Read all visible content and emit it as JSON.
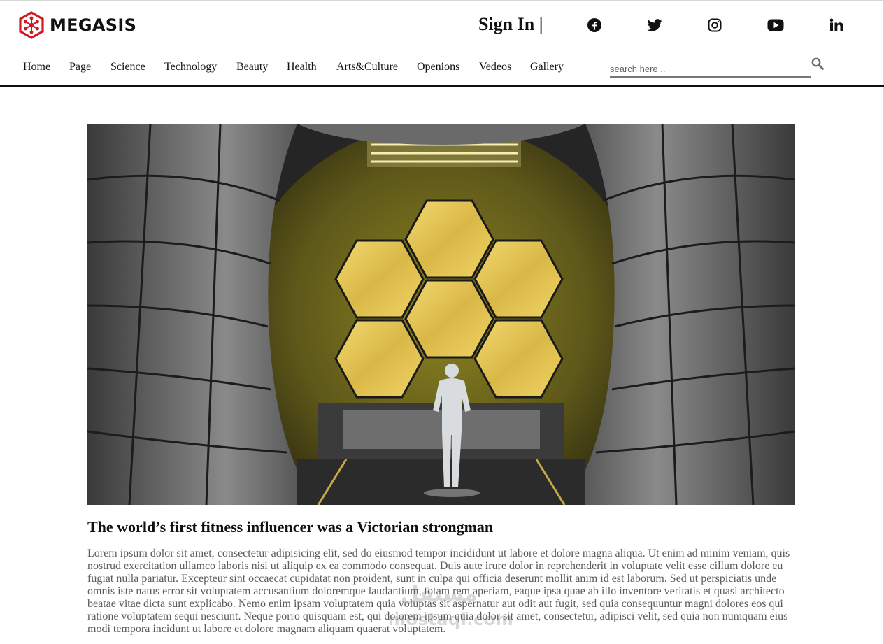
{
  "header": {
    "brand_name": "MEGASIS",
    "brand_color": "#d0181f",
    "sign_in_label": "Sign In |",
    "social_icons": [
      "facebook-icon",
      "twitter-icon",
      "instagram-icon",
      "youtube-icon",
      "linkedin-icon"
    ]
  },
  "nav": {
    "items": [
      {
        "label": "Home"
      },
      {
        "label": "Page"
      },
      {
        "label": "Science"
      },
      {
        "label": "Technology"
      },
      {
        "label": "Beauty"
      },
      {
        "label": "Health"
      },
      {
        "label": "Arts&Culture"
      },
      {
        "label": "Openions"
      },
      {
        "label": "Vedeos"
      },
      {
        "label": "Gallery"
      }
    ]
  },
  "search": {
    "placeholder": "search here ..",
    "value": "",
    "icon": "search-icon"
  },
  "article": {
    "image_icon": "telescope-mirror-photo",
    "title": "The world’s first fitness influencer was a Victorian strongman",
    "body": "Lorem ipsum dolor sit amet, consectetur adipisicing elit, sed do eiusmod tempor incididunt ut labore et dolore magna aliqua. Ut enim ad minim veniam, quis nostrud exercitation ullamco laboris nisi ut aliquip ex ea commodo consequat. Duis aute irure dolor in reprehenderit in voluptate velit esse cillum dolore eu fugiat nulla pariatur. Excepteur sint occaecat cupidatat non proident, sunt in culpa qui officia deserunt mollit anim id est laborum. Sed ut perspiciatis unde omnis iste natus error sit voluptatem accusantium doloremque laudantium, totam rem aperiam, eaque ipsa quae ab illo inventore veritatis et quasi architecto beatae vitae dicta sunt explicabo. Nemo enim ipsam voluptatem quia voluptas sit aspernatur aut odit aut fugit, sed quia consequuntur magni dolores eos qui ratione voluptatem sequi nesciunt. Neque porro quisquam est, qui dolorem ipsum quia dolor sit amet, consectetur, adipisci velit, sed quia non numquam eius modi tempora incidunt ut labore et dolore magnam aliquam quaerat voluptatem."
  },
  "watermark": {
    "arabic": "مستقل",
    "latin": "mostaql.com"
  }
}
